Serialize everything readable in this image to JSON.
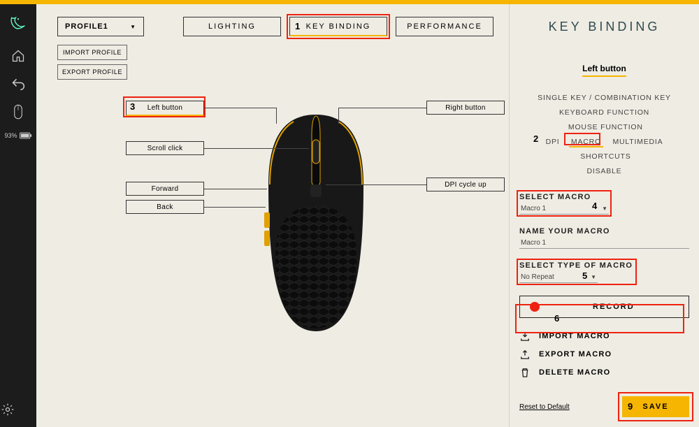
{
  "sidebar": {
    "battery": "93%"
  },
  "profile": {
    "selected": "PROFILE1",
    "import_label": "IMPORT PROFILE",
    "export_label": "EXPORT PROFILE"
  },
  "tabs": {
    "lighting": "LIGHTING",
    "keybinding": "KEY BINDING",
    "performance": "PERFORMANCE"
  },
  "mouse_labels": {
    "left": "Left button",
    "right": "Right button",
    "scroll": "Scroll click",
    "dpi": "DPI cycle up",
    "forward": "Forward",
    "back": "Back"
  },
  "steps": {
    "s1": "1",
    "s2": "2",
    "s3": "3",
    "s4": "4",
    "s5": "5",
    "s6": "6",
    "s9": "9"
  },
  "panel": {
    "title": "KEY BINDING",
    "subtitle": "Left button",
    "categories": {
      "single": "SINGLE KEY / COMBINATION KEY",
      "kbfn": "KEYBOARD FUNCTION",
      "mousefn": "MOUSE FUNCTION",
      "dpi": "DPI",
      "macro": "MACRO",
      "multimedia": "MULTIMEDIA",
      "shortcuts": "SHORTCUTS",
      "disable": "DISABLE"
    },
    "select_macro_label": "SELECT MACRO",
    "select_macro_value": "Macro 1",
    "name_macro_label": "NAME YOUR MACRO",
    "name_macro_value": "Macro 1",
    "type_macro_label": "SELECT TYPE OF MACRO",
    "type_macro_value": "No Repeat",
    "record_label": "RECORD",
    "import_macro": "IMPORT MACRO",
    "export_macro": "EXPORT MACRO",
    "delete_macro": "DELETE MACRO",
    "reset": "Reset to Default",
    "save": "SAVE"
  }
}
